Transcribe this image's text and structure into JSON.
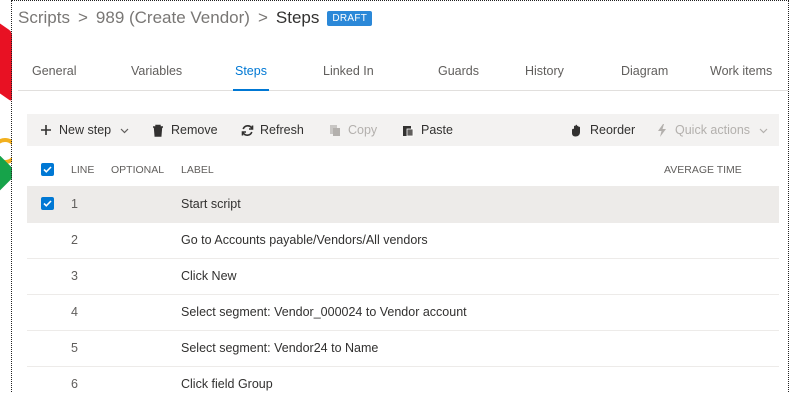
{
  "breadcrumb": {
    "items": [
      "Scripts",
      "989 (Create Vendor)"
    ],
    "separator": ">",
    "current": "Steps",
    "badge": "DRAFT"
  },
  "tabs": [
    {
      "label": "General",
      "active": false
    },
    {
      "label": "Variables",
      "active": false
    },
    {
      "label": "Steps",
      "active": true
    },
    {
      "label": "Linked In",
      "active": false
    },
    {
      "label": "Guards",
      "active": false
    },
    {
      "label": "History",
      "active": false
    },
    {
      "label": "Diagram",
      "active": false
    },
    {
      "label": "Work items",
      "active": false
    }
  ],
  "toolbar": {
    "new_step": "New step",
    "remove": "Remove",
    "refresh": "Refresh",
    "copy": "Copy",
    "paste": "Paste",
    "reorder": "Reorder",
    "quick_actions": "Quick actions"
  },
  "grid": {
    "columns": {
      "line": "LINE",
      "optional": "OPTIONAL",
      "label": "LABEL",
      "average_time": "AVERAGE TIME"
    },
    "rows": [
      {
        "line": "1",
        "label": "Start script",
        "selected": true
      },
      {
        "line": "2",
        "label": "Go to Accounts payable/Vendors/All vendors",
        "selected": false
      },
      {
        "line": "3",
        "label": "Click New",
        "selected": false
      },
      {
        "line": "4",
        "label": "Select segment: Vendor_000024 to Vendor account",
        "selected": false
      },
      {
        "line": "5",
        "label": "Select segment: Vendor24 to Name",
        "selected": false
      },
      {
        "line": "6",
        "label": "Click field Group",
        "selected": false
      }
    ]
  },
  "colors": {
    "accent": "#0078d4",
    "badge": "#2b88d8",
    "selected_row": "#edebe9",
    "toolbar_bg": "#f3f2f1"
  },
  "icons": [
    "plus-icon",
    "chevron-down-icon",
    "trash-icon",
    "refresh-icon",
    "copy-icon",
    "paste-icon",
    "hand-icon",
    "lightning-icon",
    "check-icon"
  ]
}
